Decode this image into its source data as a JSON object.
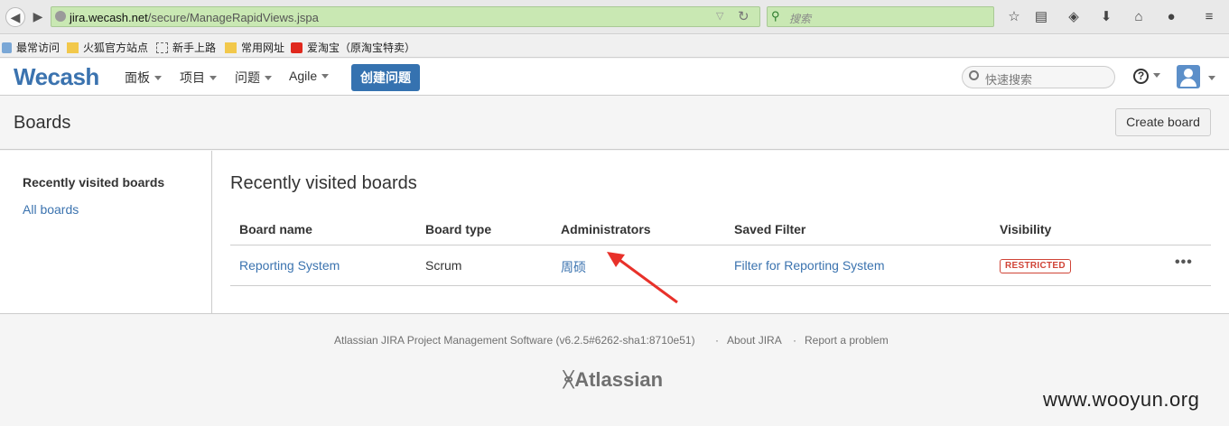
{
  "browser": {
    "url_host": "jira.wecash.net",
    "url_path": "/secure/ManageRapidViews.jspa",
    "search_placeholder": "搜索"
  },
  "bookmarks": [
    "最常访问",
    "火狐官方站点",
    "新手上路",
    "常用网址",
    "爱淘宝（原淘宝特卖）"
  ],
  "header": {
    "logo": "Wecash",
    "menus": [
      "面板",
      "项目",
      "问题",
      "Agile"
    ],
    "create_label": "创建问题",
    "quick_search_placeholder": "快速搜索",
    "help_label": "?"
  },
  "page": {
    "title": "Boards",
    "create_board_label": "Create board"
  },
  "sidebar": {
    "heading": "Recently visited boards",
    "link": "All boards"
  },
  "main": {
    "heading": "Recently visited boards",
    "columns": [
      "Board name",
      "Board type",
      "Administrators",
      "Saved Filter",
      "Visibility"
    ],
    "rows": [
      {
        "board_name": "Reporting System",
        "board_type": "Scrum",
        "administrators": "周硕",
        "saved_filter": "Filter for Reporting System",
        "visibility": "RESTRICTED",
        "more": "•••"
      }
    ]
  },
  "footer": {
    "software": "Atlassian JIRA Project Management Software (v6.2.5#6262-sha1:8710e51)",
    "sep": "·",
    "about": "About JIRA",
    "report": "Report a problem",
    "brand": "Atlassian",
    "watermark": "www.wooyun.org"
  },
  "colors": {
    "link": "#3b73af",
    "primary_button": "#3572b0",
    "restricted": "#d04437",
    "annotation_arrow": "#e8312a"
  }
}
